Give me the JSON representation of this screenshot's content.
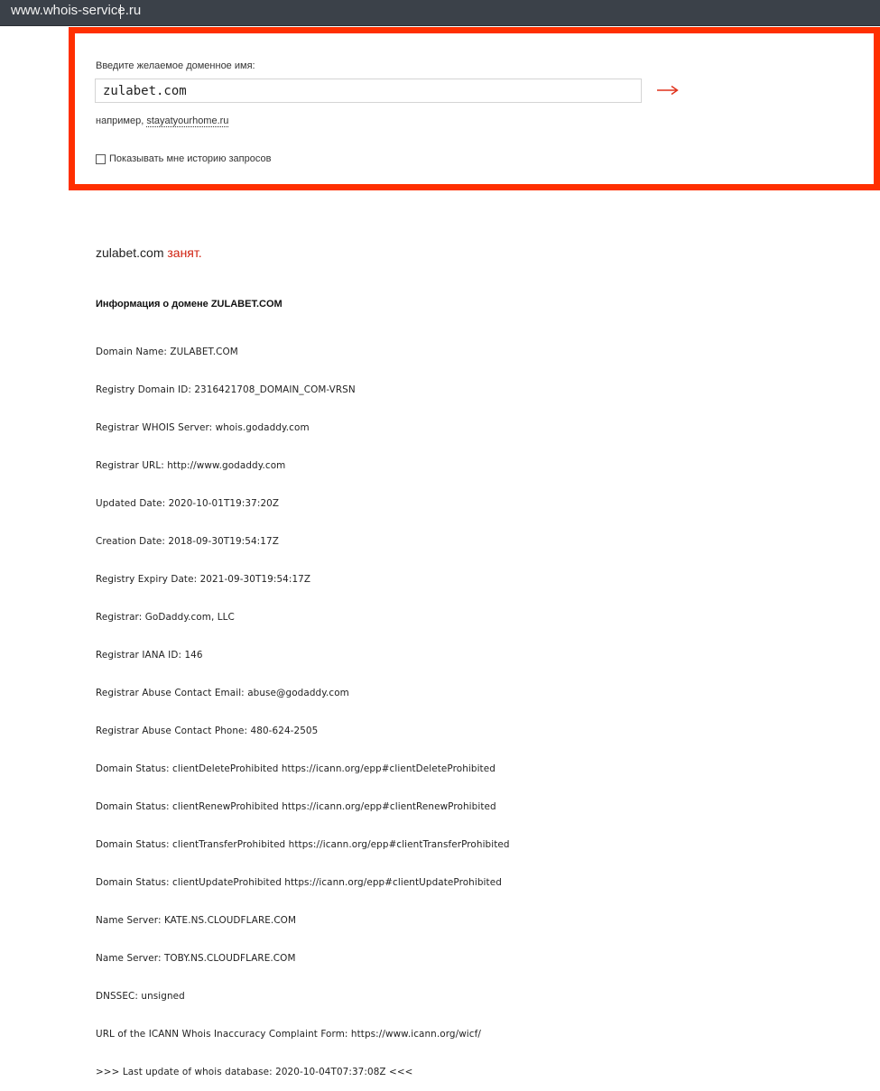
{
  "browser": {
    "url": "www.whois-service.ru"
  },
  "search": {
    "prompt_label": "Введите желаемое доменное имя:",
    "input_value": "zulabet.com",
    "example_prefix": "например,",
    "example_link": "stayatyourhome.ru",
    "history_label": "Показывать мне историю запросов",
    "submit_icon": "arrow-right-icon",
    "accent_color": "#ff2f00"
  },
  "result": {
    "domain": "zulabet.com",
    "status": "занят."
  },
  "info": {
    "title": "Информация о домене ZULABET.COM",
    "lines": [
      "Domain Name: ZULABET.COM",
      "Registry Domain ID: 2316421708_DOMAIN_COM-VRSN",
      "Registrar WHOIS Server: whois.godaddy.com",
      "Registrar URL: http://www.godaddy.com",
      "Updated Date: 2020-10-01T19:37:20Z",
      "Creation Date: 2018-09-30T19:54:17Z",
      "Registry Expiry Date: 2021-09-30T19:54:17Z",
      "Registrar: GoDaddy.com, LLC",
      "Registrar IANA ID: 146",
      "Registrar Abuse Contact Email: abuse@godaddy.com",
      "Registrar Abuse Contact Phone: 480-624-2505",
      "Domain Status: clientDeleteProhibited https://icann.org/epp#clientDeleteProhibited",
      "Domain Status: clientRenewProhibited https://icann.org/epp#clientRenewProhibited",
      "Domain Status: clientTransferProhibited https://icann.org/epp#clientTransferProhibited",
      "Domain Status: clientUpdateProhibited https://icann.org/epp#clientUpdateProhibited",
      "Name Server: KATE.NS.CLOUDFLARE.COM",
      "Name Server: TOBY.NS.CLOUDFLARE.COM",
      "DNSSEC: unsigned",
      "URL of the ICANN Whois Inaccuracy Complaint Form: https://www.icann.org/wicf/",
      ">>> Last update of whois database: 2020-10-04T07:37:08Z <<<"
    ]
  }
}
